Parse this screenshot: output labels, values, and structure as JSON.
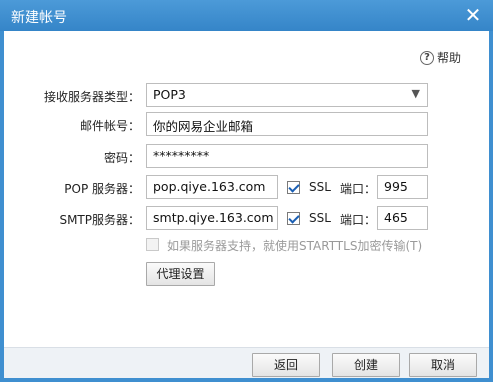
{
  "window": {
    "title": "新建帐号"
  },
  "help": {
    "label": "帮助"
  },
  "form": {
    "server_type": {
      "label": "接收服务器类型：",
      "value": "POP3"
    },
    "account": {
      "label": "邮件帐号：",
      "value": "你的网易企业邮箱"
    },
    "password": {
      "label": "密码：",
      "value": "*********"
    },
    "pop": {
      "label": "POP 服务器：",
      "value": "pop.qiye.163.com",
      "ssl_label": "SSL",
      "port_label": "端口：",
      "port": "995"
    },
    "smtp": {
      "label": "SMTP服务器：",
      "value": "smtp.qiye.163.com",
      "ssl_label": "SSL",
      "port_label": "端口：",
      "port": "465"
    },
    "starttls_label": "如果服务器支持，就使用STARTTLS加密传输(T)",
    "proxy_button": "代理设置"
  },
  "footer": {
    "back": "返回",
    "create": "创建",
    "cancel": "取消"
  }
}
